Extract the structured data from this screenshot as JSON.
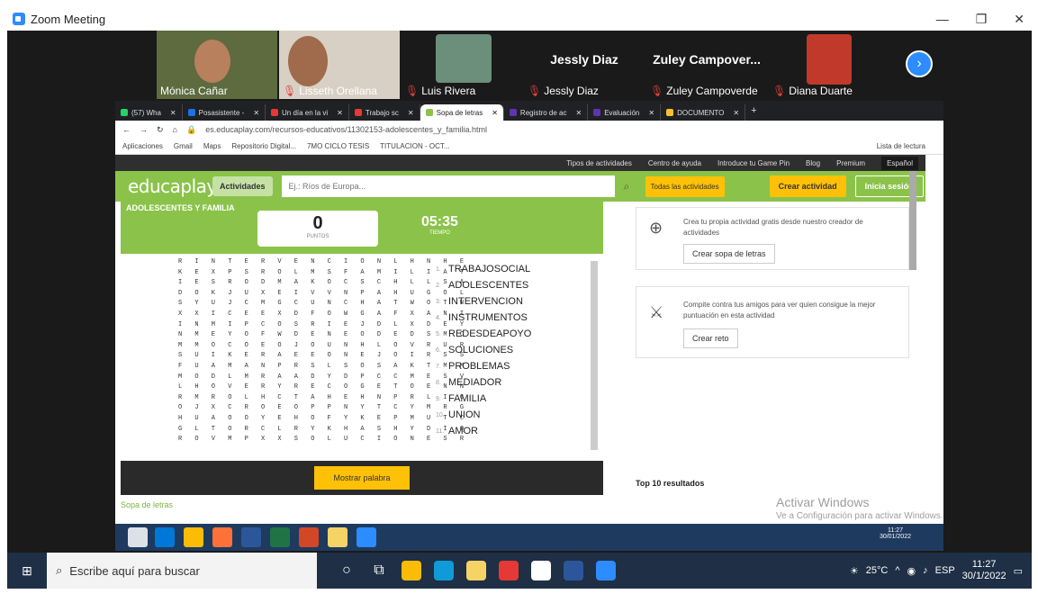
{
  "zoom": {
    "title": "Zoom Meeting",
    "participants": [
      {
        "name": "Mónica Cañar"
      },
      {
        "name": "Lisseth Orellana"
      },
      {
        "name": "Luis Rivera"
      },
      {
        "name": "Jessly Diaz",
        "big": "Jessly Diaz"
      },
      {
        "name": "Zuley Campoverde",
        "big": "Zuley Campover..."
      },
      {
        "name": "Diana Duarte"
      }
    ]
  },
  "browser": {
    "tabs": [
      {
        "label": "(57) Wha",
        "color": "#25d366"
      },
      {
        "label": "Posasistente -",
        "color": "#1a73e8"
      },
      {
        "label": "Un día en la vi",
        "color": "#e53935"
      },
      {
        "label": "Trabajo sc",
        "color": "#e53935"
      },
      {
        "label": "Sopa de letras",
        "color": "#8bc34a",
        "active": true
      },
      {
        "label": "Registro de ac",
        "color": "#5e35b1"
      },
      {
        "label": "Evaluación",
        "color": "#5e35b1"
      },
      {
        "label": "DOCUMENTO",
        "color": "#fbc02d"
      }
    ],
    "url": "es.educaplay.com/recursos-educativos/11302153-adolescentes_y_familia.html",
    "bookmarks": [
      "Aplicaciones",
      "Gmail",
      "Maps",
      "Repositorio Digital...",
      "7MO CICLO TESIS",
      "TITULACION - OCT..."
    ],
    "reading_list": "Lista de lectura"
  },
  "site": {
    "nav": [
      "Tipos de actividades",
      "Centro de ayuda",
      "Introduce tu Game Pin",
      "Blog",
      "Premium"
    ],
    "language": "Español",
    "logo": "educaplay",
    "activities_label": "Actividades",
    "search_placeholder": "Ej.: Ríos de Europa...",
    "all_activities": "Todas las actividades",
    "create_activity": "Crear actividad",
    "login": "Inicia sesión"
  },
  "game": {
    "title": "ADOLESCENTES Y FAMILIA",
    "score": "0",
    "score_label": "PUNTOS",
    "time": "05:35",
    "time_label": "TIEMPO",
    "grid": [
      "R I N T E R V E N C I O N L H N H E",
      "K E X P S R O L M S F A M I L I A T",
      "I E S R O D M A K O C S C H L L S A",
      "D O K J U X E I V V N P A H U G O L",
      "S Y U J C M G C U N C H A T W O T W",
      "X X I C E E X D F O W G A F X A N I",
      "I N M I P C O S R I E J D L X D E Y",
      "N M E Y O F W D E N E O D E D S M C",
      "M M O C O E O J O U N H L O V R U R",
      "S U I K E R A E E O N E J O I R S S",
      "F U A M A N P R S L S O S A K T M M",
      "M O D L M R A A D Y D P C C M E S V",
      "L H O V E R Y R E C O G E T O E N N",
      "R M R O L H C T A H E H N P R L I C",
      "O J X C R O E O P P N Y T C Y M R G",
      "H U A O O Y E H O F Y K E P M U T C",
      "G L T O R C L R Y K H A S H Y D I Q",
      "R O V M P X X S O L U C I O N E S R"
    ],
    "words": [
      "TRABAJOSOCIAL",
      "ADOLESCENTES",
      "INTERVENCION",
      "INSTRUMENTOS",
      "REDESDEAPOYO",
      "SOLUCIONES",
      "PROBLEMAS",
      "MEDIADOR",
      "FAMILIA",
      "UNION",
      "AMOR"
    ],
    "show_word": "Mostrar palabra",
    "footer_label": "Sopa de letras"
  },
  "sidebar": {
    "create_desc": "Crea tu propia actividad gratis desde nuestro creador de actividades",
    "create_btn": "Crear sopa de letras",
    "compete_desc": "Compite contra tus amigos para ver quien consigue la mejor puntuación en esta actividad",
    "compete_btn": "Crear reto",
    "top10": "Top 10 resultados"
  },
  "watermark": {
    "line1": "Activar Windows",
    "line2": "Ve a Configuración para activar Windows."
  },
  "inner_clock": {
    "time": "11:27",
    "date": "30/01/2022"
  },
  "taskbar": {
    "search_placeholder": "Escribe aquí para buscar",
    "temp": "25°C",
    "lang": "ESP",
    "time": "11:27",
    "date": "30/1/2022"
  }
}
